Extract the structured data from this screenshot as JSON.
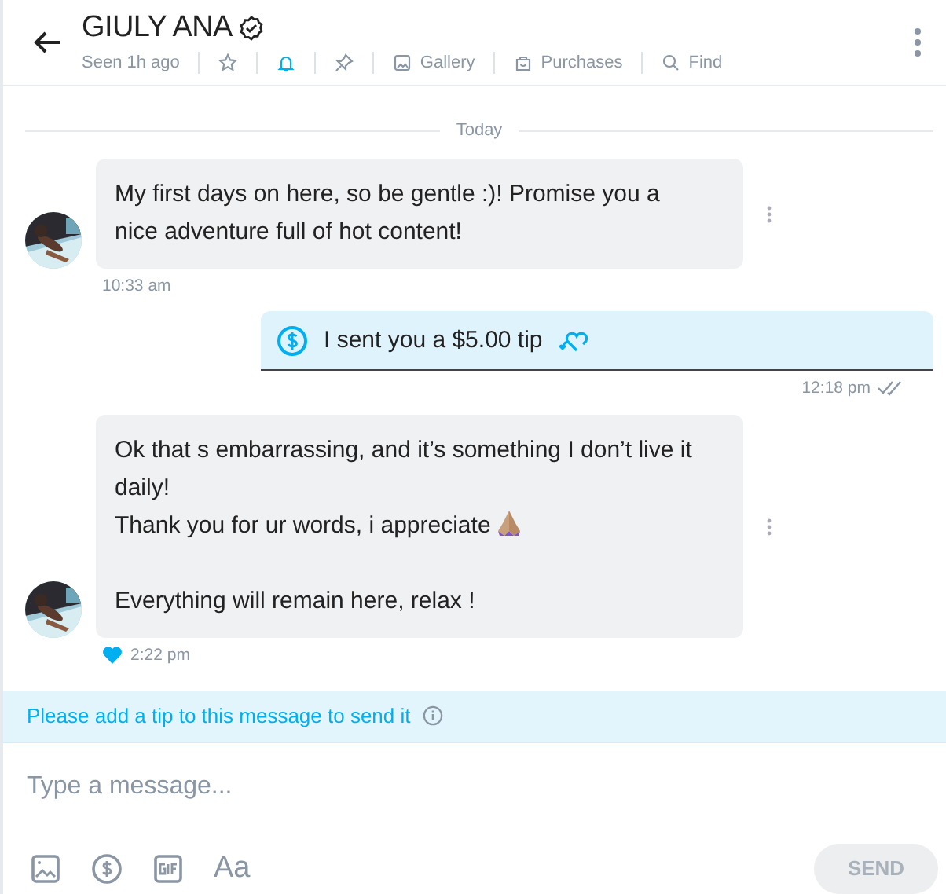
{
  "header": {
    "name": "GIULY ANA",
    "verified": true,
    "seen": "Seen 1h ago",
    "actions": [
      {
        "kind": "star",
        "active": false
      },
      {
        "kind": "bell",
        "active": true
      },
      {
        "kind": "pin",
        "active": false
      },
      {
        "kind": "gallery",
        "label": "Gallery",
        "active": false
      },
      {
        "kind": "bag",
        "label": "Purchases",
        "active": false
      },
      {
        "kind": "search",
        "label": "Find",
        "active": false
      }
    ]
  },
  "divider": "Today",
  "messages": [
    {
      "kind": "incoming",
      "paragraphs": [
        {
          "text": "My first days on here, so be gentle :)! Promise you a nice adventure full of hot content!"
        }
      ],
      "time": "10:33 am",
      "liked": false
    },
    {
      "kind": "tip",
      "title": "I sent you a $5.00 tip",
      "time": "12:18 pm",
      "read": true
    },
    {
      "kind": "incoming",
      "paragraphs": [
        {
          "text": "Ok that s embarrassing, and it’s something I don’t live it daily!"
        },
        {
          "text": "Thank you for ur words, i appreciate",
          "emoji": true
        },
        {
          "text": "Everything will remain here, relax !",
          "gap_before": true
        }
      ],
      "time": "2:22 pm",
      "liked": true
    }
  ],
  "notice": "Please add a tip to this message to send it",
  "composer": {
    "placeholder": "Type a message...",
    "font_button": "Aa",
    "send": "SEND",
    "send_disabled": true
  }
}
